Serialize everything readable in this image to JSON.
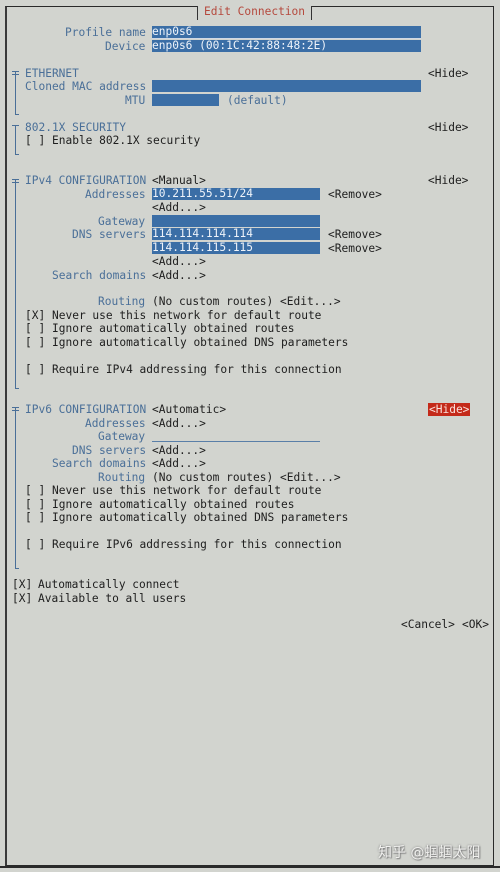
{
  "window": {
    "title": "Edit Connection"
  },
  "profile": {
    "name_label": "Profile name",
    "name_value": "enp0s6",
    "device_label": "Device",
    "device_value": "enp0s6 (00:1C:42:88:48:2E)"
  },
  "ethernet": {
    "header": "ETHERNET",
    "toggle": "<Hide>",
    "cloned_mac_label": "Cloned MAC address",
    "cloned_mac_value": "",
    "mtu_label": "MTU",
    "mtu_value": "",
    "mtu_hint": "(default)"
  },
  "security": {
    "header": "802.1X SECURITY",
    "toggle": "<Hide>",
    "enable_checkbox": "[ ]",
    "enable_label": "Enable 802.1X security"
  },
  "ipv4": {
    "header": "IPv4 CONFIGURATION",
    "mode": "<Manual>",
    "toggle": "<Hide>",
    "addresses_label": "Addresses",
    "addresses": [
      "10.211.55.51/24"
    ],
    "remove_label": "<Remove>",
    "add_label": "<Add...>",
    "gateway_label": "Gateway",
    "gateway_value": "",
    "dns_label": "DNS servers",
    "dns_servers": [
      "114.114.114.114",
      "114.114.115.115"
    ],
    "search_domains_label": "Search domains",
    "routing_label": "Routing",
    "routing_value": "(No custom routes)",
    "routing_edit": "<Edit...>",
    "options": [
      {
        "box": "[X]",
        "label": "Never use this network for default route",
        "checked": true
      },
      {
        "box": "[ ]",
        "label": "Ignore automatically obtained routes",
        "checked": false
      },
      {
        "box": "[ ]",
        "label": "Ignore automatically obtained DNS parameters",
        "checked": false
      }
    ],
    "require": {
      "box": "[ ]",
      "label": "Require IPv4 addressing for this connection",
      "checked": false
    }
  },
  "ipv6": {
    "header": "IPv6 CONFIGURATION",
    "mode": "<Automatic>",
    "toggle": "<Hide>",
    "addresses_label": "Addresses",
    "add_label": "<Add...>",
    "gateway_label": "Gateway",
    "gateway_value": "",
    "dns_label": "DNS servers",
    "search_domains_label": "Search domains",
    "routing_label": "Routing",
    "routing_value": "(No custom routes)",
    "routing_edit": "<Edit...>",
    "options": [
      {
        "box": "[ ]",
        "label": "Never use this network for default route",
        "checked": false
      },
      {
        "box": "[ ]",
        "label": "Ignore automatically obtained routes",
        "checked": false
      },
      {
        "box": "[ ]",
        "label": "Ignore automatically obtained DNS parameters",
        "checked": false
      }
    ],
    "require": {
      "box": "[ ]",
      "label": "Require IPv6 addressing for this connection",
      "checked": false
    }
  },
  "general": {
    "auto_connect": {
      "box": "[X]",
      "label": "Automatically connect",
      "checked": true
    },
    "all_users": {
      "box": "[X]",
      "label": "Available to all users",
      "checked": true
    }
  },
  "buttons": {
    "cancel": "<Cancel>",
    "ok": "<OK>"
  },
  "watermark": "知乎 @蝈蝈太阳",
  "colors": {
    "background": "#d2d4cf",
    "label": "#4a6f98",
    "field": "#3b6ea6",
    "title": "#b5493d",
    "focus": "#c42a1a"
  }
}
